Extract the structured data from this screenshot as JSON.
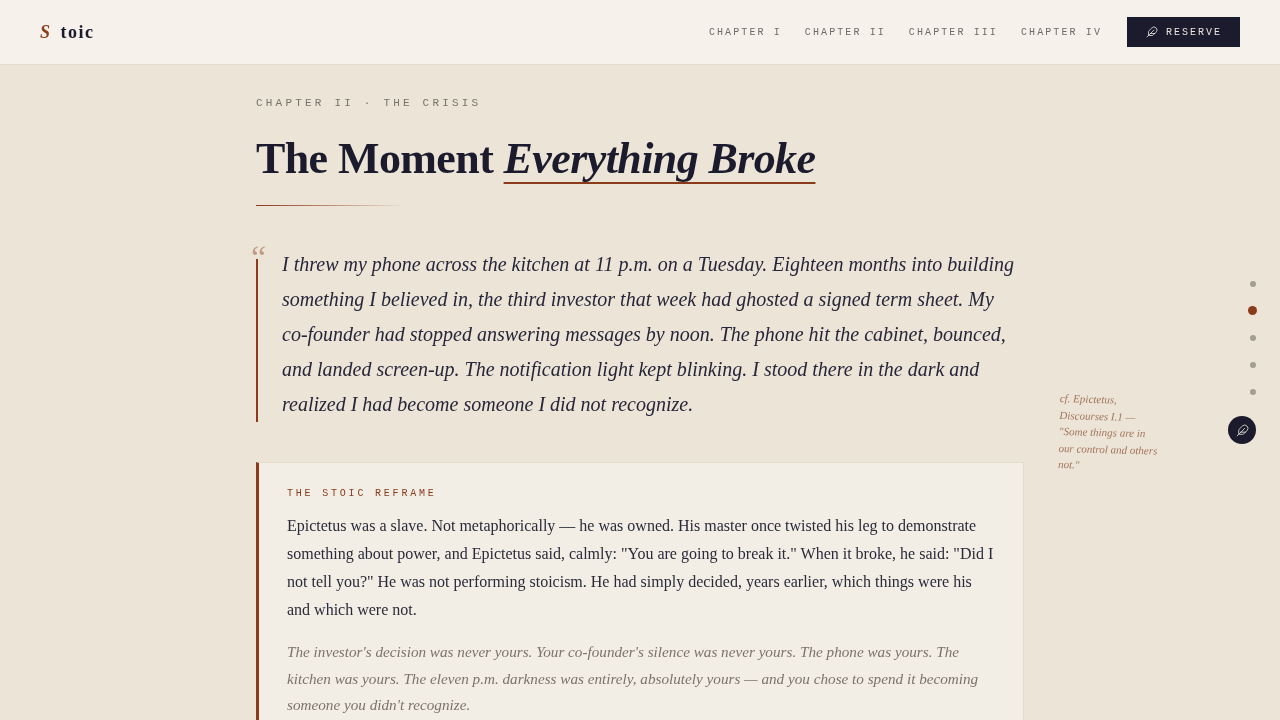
{
  "header": {
    "logo": {
      "initial": "S",
      "rest": "toic"
    },
    "nav": [
      {
        "label": "CHAPTER I"
      },
      {
        "label": "CHAPTER II"
      },
      {
        "label": "CHAPTER III"
      },
      {
        "label": "CHAPTER IV"
      }
    ],
    "cta": {
      "label": "RESERVE"
    }
  },
  "article": {
    "eyebrow": "CHAPTER II · THE CRISIS",
    "title": {
      "plain": "The Moment",
      "emphasis": "Everything Broke"
    },
    "quote": {
      "mark": "“",
      "text": "I threw my phone across the kitchen at 11 p.m. on a Tuesday. Eighteen months into building something I believed in, the third investor that week had ghosted a signed term sheet. My co-founder had stopped answering messages by noon. The phone hit the cabinet, bounced, and landed screen-up. The notification light kept blinking. I stood there in the dark and realized I had become someone I did not recognize."
    },
    "margin_note": "cf. Epictetus, Discourses I.1 — \"Some things are in our control and others not.\"",
    "reframe": {
      "label": "THE STOIC REFRAME",
      "body": "Epictetus was a slave. Not metaphorically — he was owned. His master once twisted his leg to demonstrate something about power, and Epictetus said, calmly: \"You are going to break it.\" When it broke, he said: \"Did I not tell you?\" He was not performing stoicism. He had simply decided, years earlier, which things were his and which were not.",
      "aside": "The investor's decision was never yours. Your co-founder's silence was never yours. The phone was yours. The kitchen was yours. The eleven p.m. darkness was entirely, absolutely yours — and you chose to spend it becoming someone you didn't recognize."
    }
  },
  "progress_dots": [
    {
      "selected": false
    },
    {
      "selected": true
    },
    {
      "selected": false
    },
    {
      "selected": false
    },
    {
      "selected": false
    }
  ]
}
